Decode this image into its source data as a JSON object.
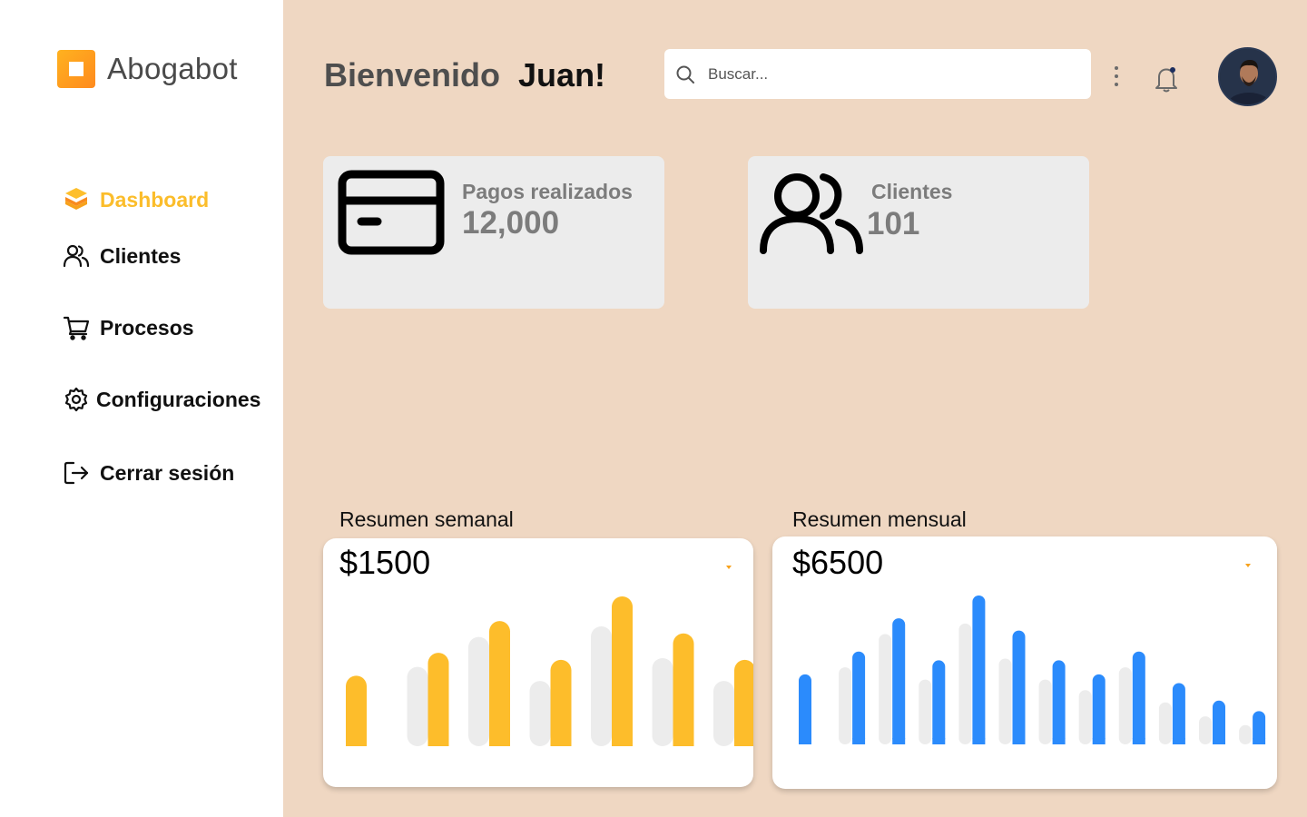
{
  "brand": {
    "name": "Abogabot"
  },
  "sidebar": {
    "items": [
      {
        "label": "Dashboard",
        "icon": "layers-icon",
        "active": true
      },
      {
        "label": "Clientes",
        "icon": "users-icon"
      },
      {
        "label": "Procesos",
        "icon": "cart-icon"
      },
      {
        "label": "Configuraciones",
        "icon": "gear-icon"
      },
      {
        "label": "Cerrar sesión",
        "icon": "logout-icon"
      }
    ]
  },
  "header": {
    "greeting": "Bienvenido",
    "user": "Juan!"
  },
  "search": {
    "placeholder": "Buscar..."
  },
  "stats": [
    {
      "label": "Pagos realizados",
      "value": "12,000",
      "icon": "credit-card-icon"
    },
    {
      "label": "Clientes",
      "value": "101",
      "icon": "users-icon"
    }
  ],
  "colors": {
    "accent": "#fbbd2b",
    "background": "#efd7c2",
    "weekly_bar": "#fdbd2b",
    "monthly_bar": "#2b8bfc",
    "ghost_bar": "#ececec"
  },
  "chart_data": [
    {
      "type": "bar",
      "title": "Resumen semanal",
      "total": "$1500",
      "series": [
        {
          "values": [
            0,
            45,
            62,
            37,
            68,
            50,
            37
          ]
        },
        {
          "values": [
            40,
            53,
            71,
            49,
            85,
            64,
            49
          ]
        }
      ]
    },
    {
      "type": "bar",
      "title": "Resumen mensual",
      "total": "$6500",
      "series": [
        {
          "values": [
            0,
            44,
            63,
            37,
            69,
            49,
            37,
            31,
            44,
            24,
            16,
            11
          ]
        },
        {
          "values": [
            40,
            53,
            72,
            48,
            85,
            65,
            48,
            40,
            53,
            35,
            25,
            19
          ]
        }
      ]
    }
  ]
}
